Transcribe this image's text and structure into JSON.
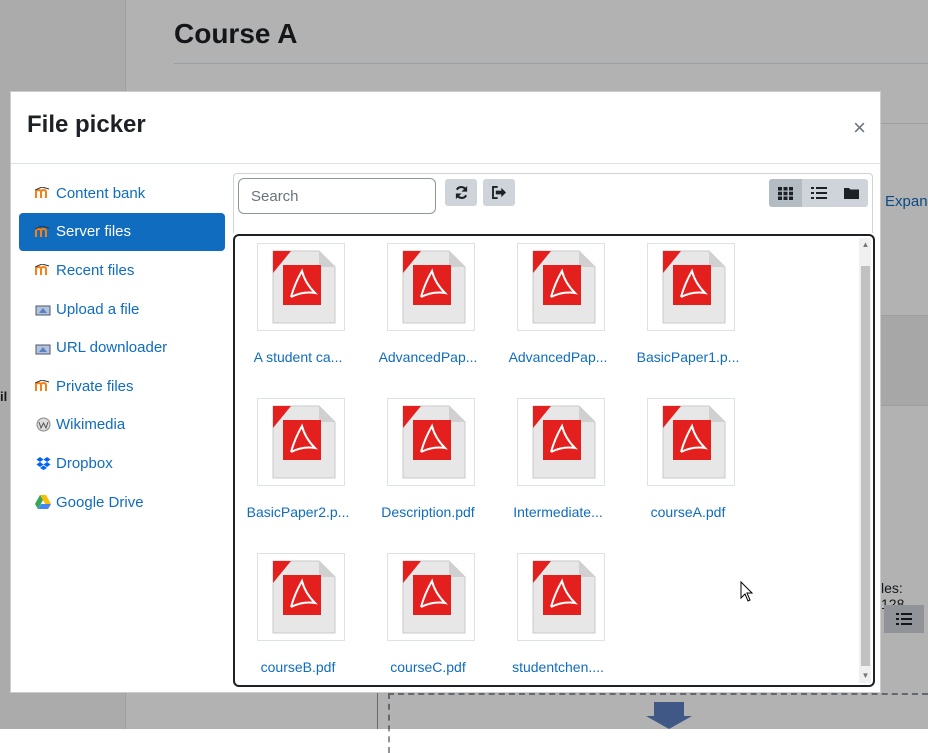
{
  "background": {
    "course_title": "Course A",
    "expand_link": "Expand",
    "files_label": "les: 128",
    "fil_label": "il"
  },
  "modal": {
    "title": "File picker",
    "close_glyph": "×"
  },
  "sidebar": {
    "items": [
      {
        "label": "Content bank",
        "icon": "moodle-icon"
      },
      {
        "label": "Server files",
        "icon": "moodle-icon",
        "active": true
      },
      {
        "label": "Recent files",
        "icon": "moodle-icon"
      },
      {
        "label": "Upload a file",
        "icon": "upload-icon"
      },
      {
        "label": "URL downloader",
        "icon": "url-icon"
      },
      {
        "label": "Private files",
        "icon": "moodle-icon"
      },
      {
        "label": "Wikimedia",
        "icon": "wikimedia-icon"
      },
      {
        "label": "Dropbox",
        "icon": "dropbox-icon"
      },
      {
        "label": "Google Drive",
        "icon": "google-drive-icon"
      }
    ]
  },
  "toolbar": {
    "search_placeholder": "Search",
    "refresh_icon": "refresh-icon",
    "logout_icon": "logout-icon",
    "view_modes": [
      "icons-view",
      "list-view",
      "tree-view"
    ],
    "active_view": "icons-view"
  },
  "files": [
    "A student ca...",
    "AdvancedPap...",
    "AdvancedPap...",
    "BasicPaper1.p...",
    "BasicPaper2.p...",
    "Description.pdf",
    "Intermediate...",
    "courseA.pdf",
    "courseB.pdf",
    "courseC.pdf",
    "studentchen...."
  ],
  "colors": {
    "link": "#0f6cbf",
    "active_bg": "#0f6cbf",
    "pdf_red": "#e4201e",
    "button_bg": "#ced4da"
  }
}
